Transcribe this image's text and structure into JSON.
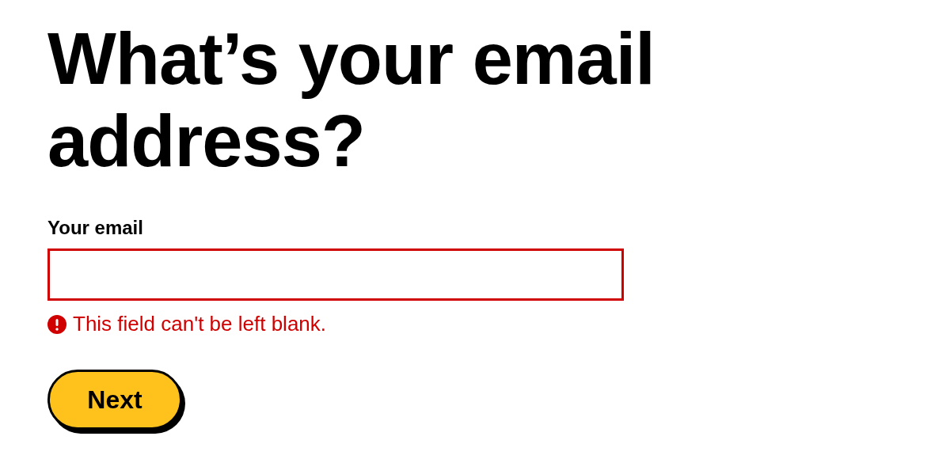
{
  "heading": "What’s your email address?",
  "field": {
    "label": "Your email",
    "invalid": true,
    "error": "This field can't be left blank."
  },
  "button": {
    "label": "Next"
  }
}
